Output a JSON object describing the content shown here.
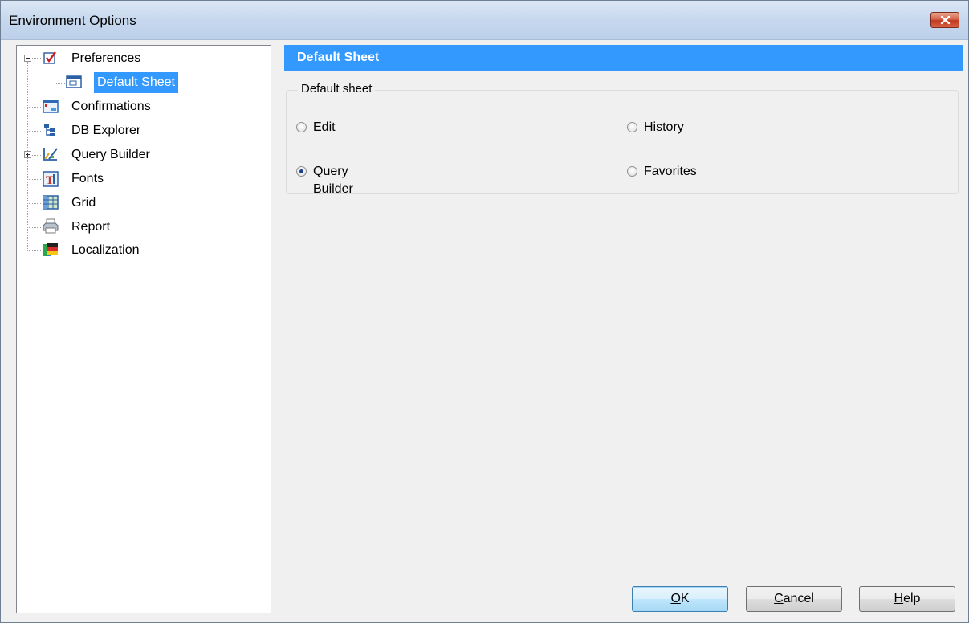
{
  "window": {
    "title": "Environment Options"
  },
  "tree": {
    "items": [
      {
        "label": "Preferences",
        "icon": "checkbox-icon"
      },
      {
        "label": "Default Sheet",
        "icon": "sheet-icon",
        "selected": true
      },
      {
        "label": "Confirmations",
        "icon": "dialog-icon"
      },
      {
        "label": "DB Explorer",
        "icon": "tree-structure-icon"
      },
      {
        "label": "Query Builder",
        "icon": "query-builder-icon"
      },
      {
        "label": "Fonts",
        "icon": "font-icon"
      },
      {
        "label": "Grid",
        "icon": "grid-icon"
      },
      {
        "label": "Report",
        "icon": "printer-icon"
      },
      {
        "label": "Localization",
        "icon": "flags-icon"
      }
    ]
  },
  "panel": {
    "header": "Default Sheet",
    "group_title": "Default sheet",
    "options": [
      {
        "label": "Edit",
        "checked": false
      },
      {
        "label": "History",
        "checked": false
      },
      {
        "label": "Query Builder",
        "checked": true
      },
      {
        "label": "Favorites",
        "checked": false
      }
    ]
  },
  "buttons": {
    "ok": {
      "mnemonic": "O",
      "rest": "K"
    },
    "cancel": {
      "mnemonic": "C",
      "rest": "ancel"
    },
    "help": {
      "mnemonic": "H",
      "rest": "elp"
    }
  },
  "colors": {
    "selection": "#3399ff",
    "header": "#3399ff",
    "close": "#c0381f"
  }
}
